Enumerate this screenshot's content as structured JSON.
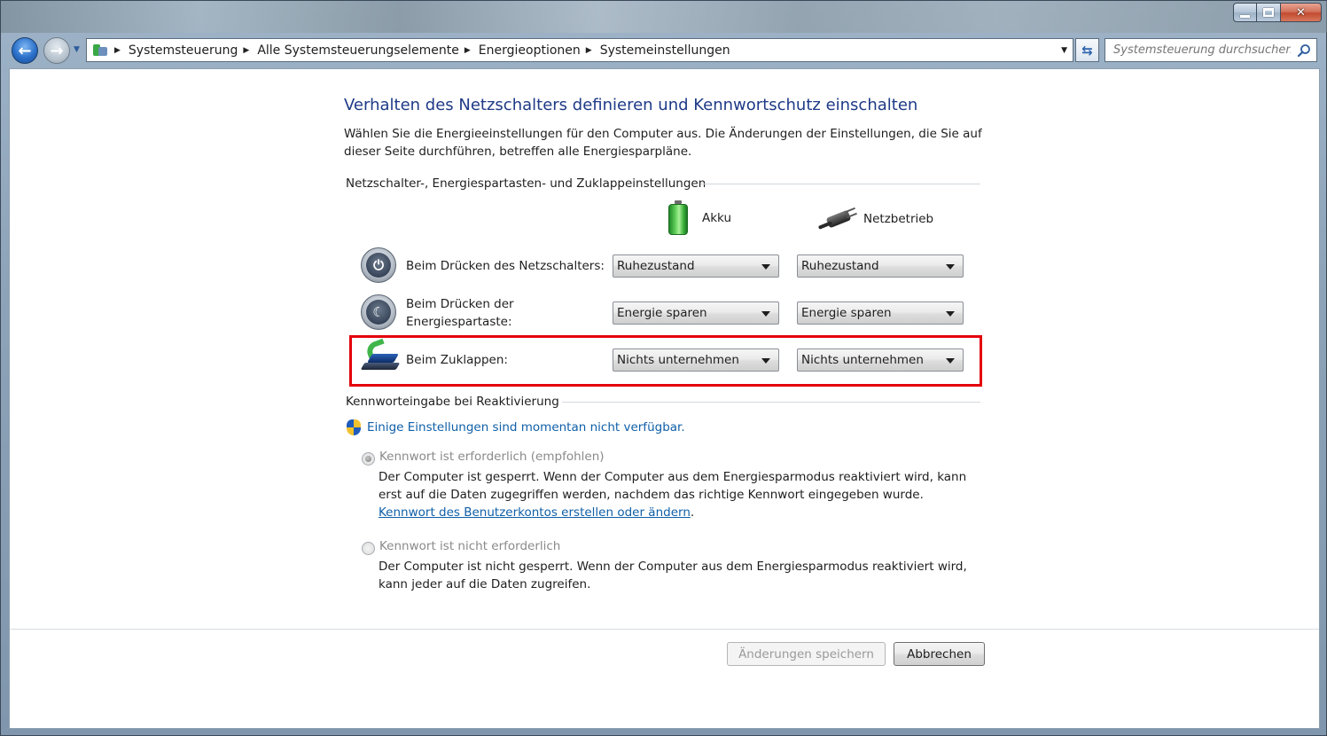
{
  "window": {
    "breadcrumbs": [
      "Systemsteuerung",
      "Alle Systemsteuerungselemente",
      "Energieoptionen",
      "Systemeinstellungen"
    ],
    "search_placeholder": "Systemsteuerung durchsuchen"
  },
  "page": {
    "title": "Verhalten des Netzschalters definieren und Kennwortschutz einschalten",
    "description": "Wählen Sie die Energieeinstellungen für den Computer aus. Die Änderungen der Einstellungen, die Sie auf dieser Seite durchführen, betreffen alle Energiesparpläne."
  },
  "buttons_section": {
    "heading": "Netzschalter-, Energiespartasten- und Zuklappeinstellungen",
    "columns": {
      "battery": "Akku",
      "ac": "Netzbetrieb"
    },
    "rows": [
      {
        "label": "Beim Drücken des Netzschalters:",
        "battery": "Ruhezustand",
        "ac": "Ruhezustand"
      },
      {
        "label": "Beim Drücken der Energiespartaste:",
        "battery": "Energie sparen",
        "ac": "Energie sparen"
      },
      {
        "label": "Beim Zuklappen:",
        "battery": "Nichts unternehmen",
        "ac": "Nichts unternehmen"
      }
    ]
  },
  "password_section": {
    "heading": "Kennworteingabe bei Reaktivierung",
    "notice": "Einige Einstellungen sind momentan nicht verfügbar.",
    "option_required": {
      "label": "Kennwort ist erforderlich (empfohlen)",
      "description": "Der Computer ist gesperrt. Wenn der Computer aus dem Energiesparmodus reaktiviert wird, kann erst auf die Daten zugegriffen werden, nachdem das richtige Kennwort eingegeben wurde.",
      "link": "Kennwort des Benutzerkontos erstellen oder ändern",
      "link_suffix": ".",
      "selected": true
    },
    "option_not_required": {
      "label": "Kennwort ist nicht erforderlich",
      "description": "Der Computer ist nicht gesperrt. Wenn der Computer aus dem Energiesparmodus reaktiviert wird, kann jeder auf die Daten zugreifen.",
      "selected": false
    }
  },
  "footer": {
    "save_label": "Änderungen speichern",
    "cancel_label": "Abbrechen"
  },
  "colors": {
    "title": "#1e3a87",
    "link": "#0f5fa8",
    "highlight": "#e3000b"
  }
}
